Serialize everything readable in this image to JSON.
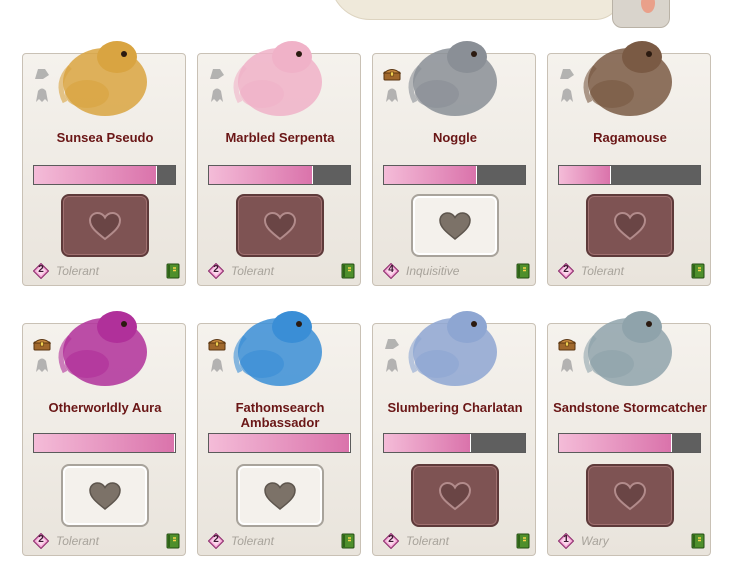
{
  "cards": [
    {
      "name": "Sunsea Pseudo",
      "level": "2",
      "temperament": "Tolerant",
      "bond_fraction": 0.87,
      "pet_state": "active",
      "has_chest": false
    },
    {
      "name": "Marbled Serpenta",
      "level": "2",
      "temperament": "Tolerant",
      "bond_fraction": 0.74,
      "pet_state": "active",
      "has_chest": false
    },
    {
      "name": "Noggle",
      "level": "4",
      "temperament": "Inquisitive",
      "bond_fraction": 0.66,
      "pet_state": "done",
      "has_chest": true
    },
    {
      "name": "Ragamouse",
      "level": "2",
      "temperament": "Tolerant",
      "bond_fraction": 0.37,
      "pet_state": "active",
      "has_chest": false
    },
    {
      "name": "Otherworldly Aura",
      "level": "2",
      "temperament": "Tolerant",
      "bond_fraction": 1.0,
      "pet_state": "done",
      "has_chest": true
    },
    {
      "name": "Fathomsearch Ambassador",
      "level": "2",
      "temperament": "Tolerant",
      "bond_fraction": 1.0,
      "pet_state": "done",
      "has_chest": true
    },
    {
      "name": "Slumbering Charlatan",
      "level": "2",
      "temperament": "Tolerant",
      "bond_fraction": 0.62,
      "pet_state": "active",
      "has_chest": false
    },
    {
      "name": "Sandstone Stormcatcher",
      "level": "1",
      "temperament": "Wary",
      "bond_fraction": 0.8,
      "pet_state": "active",
      "has_chest": true
    }
  ],
  "art_colors": [
    "#d9a441",
    "#f0b2c8",
    "#8a8f96",
    "#7a5a44",
    "#b0309a",
    "#3a8ed6",
    "#8ea6d2",
    "#8fa3ab"
  ],
  "icons": {
    "chest": "treasure-chest-icon",
    "ghost": "ghost-familiar-icon",
    "heart": "heart-icon",
    "level": "level-badge-icon",
    "bestiary": "bestiary-book-icon"
  },
  "colors": {
    "name_text": "#6a1616",
    "meter_fill": "#da73ab",
    "pet_active": "#7e5353",
    "pet_done": "#f4f1ec"
  }
}
